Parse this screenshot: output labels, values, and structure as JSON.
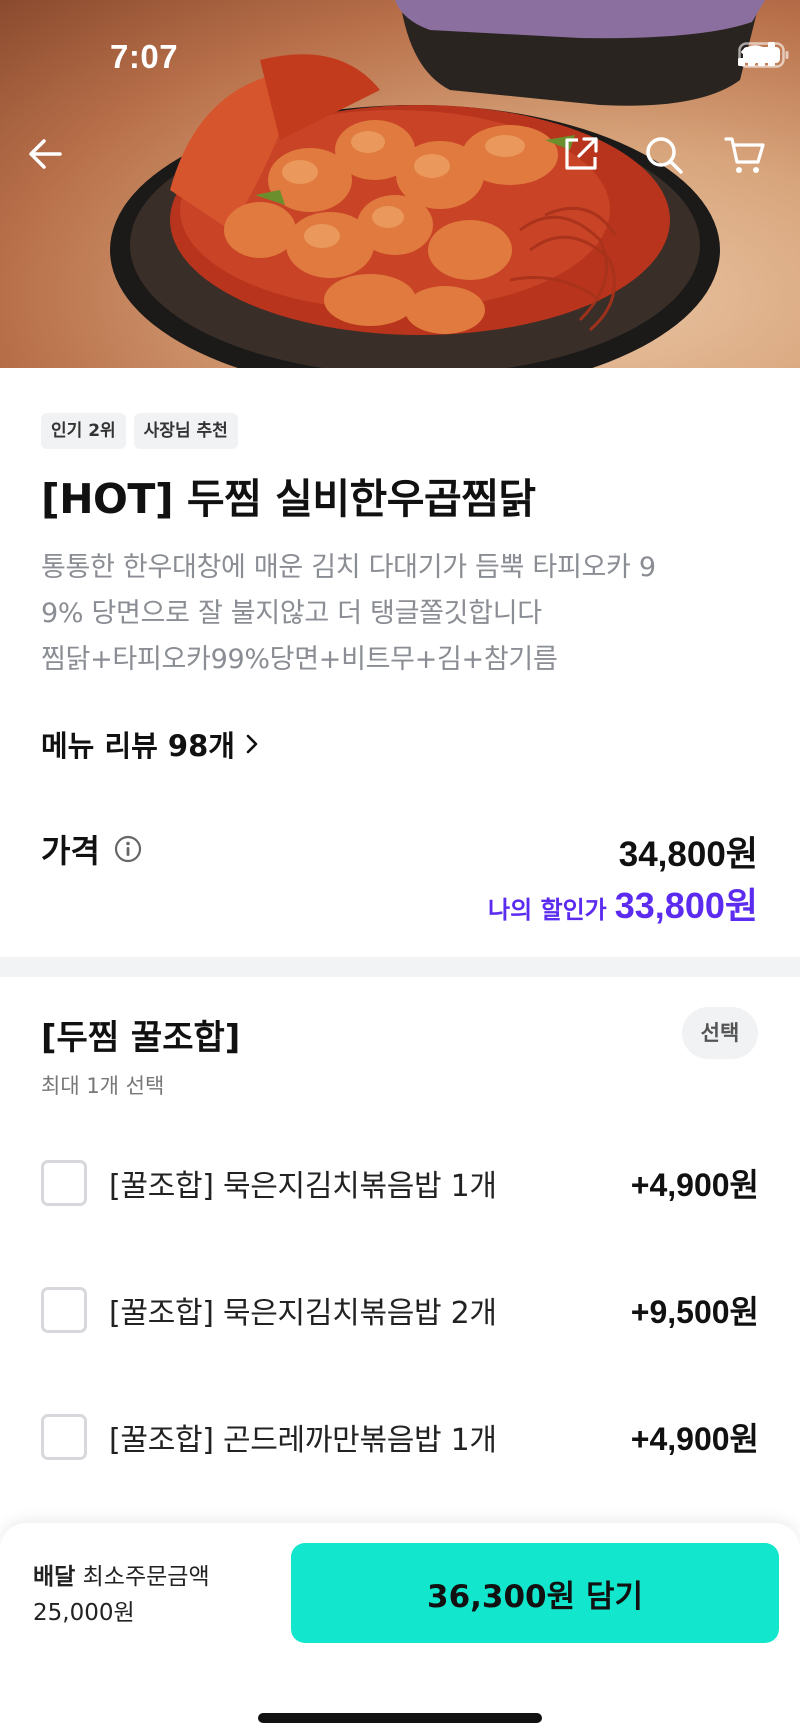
{
  "status_bar": {
    "time": "7:07"
  },
  "header_icons": [
    "back-arrow-icon",
    "share-icon",
    "search-icon",
    "cart-icon"
  ],
  "product": {
    "badges": [
      "인기 2위",
      "사장님 추천"
    ],
    "title": "[HOT] 두찜 실비한우곱찜닭",
    "description_lines": [
      "통통한 한우대창에 매운 김치 다대기가 듬뿍  타피오카 9",
      "9% 당면으로 잘 불지않고 더 탱글쫄깃합니다",
      "찜닭+타피오카99%당면+비트무+김+참기름"
    ],
    "review_link": "메뉴 리뷰 98개"
  },
  "price": {
    "label": "가격",
    "original": "34,800원",
    "discount_label": "나의 할인가",
    "discount": "33,800원",
    "discount_color": "#5b2cf0"
  },
  "option_group": {
    "title": "[두찜 꿀조합]",
    "select_label": "선택",
    "subtitle": "최대 1개 선택",
    "options": [
      {
        "name": "[꿀조합] 묵은지김치볶음밥 1개",
        "price": "+4,900원",
        "checked": false
      },
      {
        "name": "[꿀조합] 묵은지김치볶음밥 2개",
        "price": "+9,500원",
        "checked": false
      },
      {
        "name": "[꿀조합] 곤드레까만볶음밥 1개",
        "price": "+4,900원",
        "checked": false
      }
    ]
  },
  "bottom_bar": {
    "delivery_label": "배달",
    "min_order_label": "최소주문금액",
    "min_order_amount": "25,000원",
    "cta_label": "36,300원 담기",
    "cta_color": "#12e6cd"
  }
}
